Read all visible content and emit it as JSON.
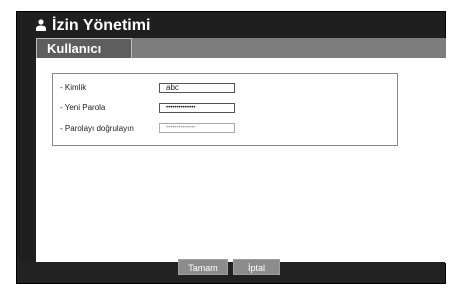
{
  "dialog": {
    "title": "İzin Yönetimi",
    "title_icon": "user-icon"
  },
  "tabs": [
    {
      "label": "Kullanıcı",
      "active": true
    }
  ],
  "form": {
    "fields": [
      {
        "label": "- Kimlik",
        "value": "abc"
      },
      {
        "label": "- Yeni Parola",
        "value": "••••••••••••••"
      },
      {
        "label": "- Parolayı doğrulayın",
        "value": "••••••••••••••"
      }
    ]
  },
  "buttons": {
    "ok": "Tamam",
    "cancel": "İptal"
  },
  "colors": {
    "frame_bg": "#1f1f1f",
    "tab_strip": "#7d7d7d",
    "tab_active": "#5e5e5e",
    "button_bg": "#8c8c8c"
  }
}
